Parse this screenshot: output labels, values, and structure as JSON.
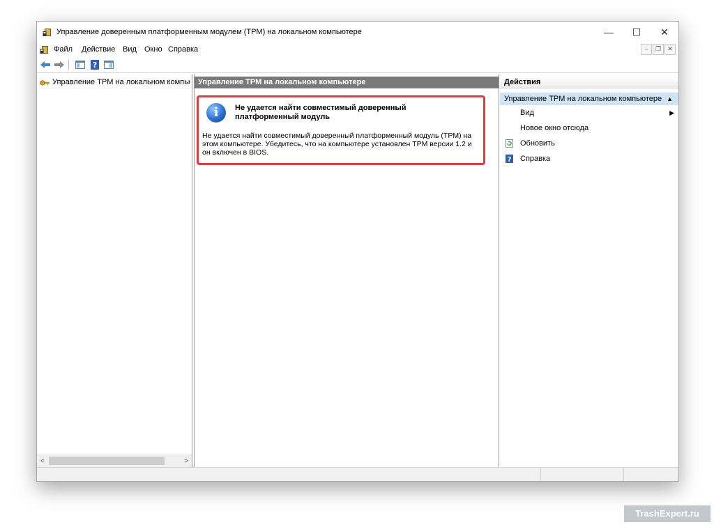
{
  "window": {
    "title": "Управление доверенным платформенным модулем (TPM) на локальном компьютере",
    "controls": {
      "minimize": "—",
      "maximize": "☐",
      "close": "✕"
    }
  },
  "menu": {
    "items": [
      "Файл",
      "Действие",
      "Вид",
      "Окно",
      "Справка"
    ]
  },
  "tree": {
    "item_label": "Управление TPM на локальном компьютере"
  },
  "center": {
    "header": "Управление TPM на локальном компьютере",
    "message_title": "Не удается найти совместимый доверенный платформенный модуль",
    "message_text": "Не удается найти совместимый доверенный платформенный модуль (TPM) на этом компьютере. Убедитесь, что на компьютере установлен TPM версии 1.2 и он включен в BIOS."
  },
  "actions": {
    "header": "Действия",
    "section": "Управление TPM на локальном компьютере",
    "items": [
      {
        "label": "Вид",
        "icon": "none",
        "submenu": true
      },
      {
        "label": "Новое окно отсюда",
        "icon": "none",
        "submenu": false
      },
      {
        "label": "Обновить",
        "icon": "refresh-icon",
        "submenu": false
      },
      {
        "label": "Справка",
        "icon": "help-icon",
        "submenu": false
      }
    ]
  },
  "watermark": "TrashExpert.ru",
  "colors": {
    "highlight_border": "#e03a3e",
    "section_bg": "#cfe3f7",
    "header_bg": "#7a7a7a"
  }
}
